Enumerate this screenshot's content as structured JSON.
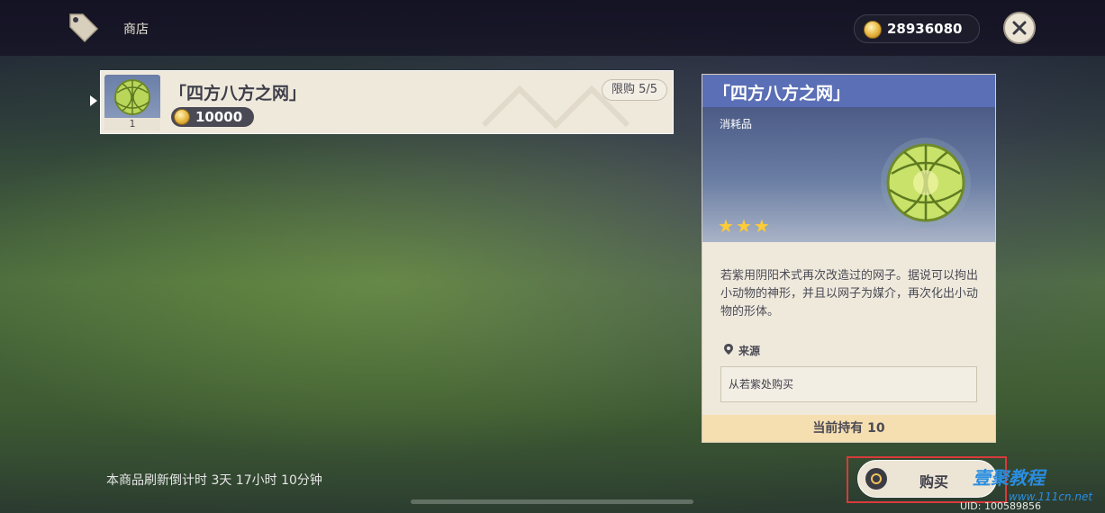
{
  "header": {
    "shop_title": "商店",
    "currency_amount": "28936080"
  },
  "shop_item": {
    "name": "「四方八方之网」",
    "price": "10000",
    "limit": "限购 5/5",
    "stack_count": "1"
  },
  "detail": {
    "title": "「四方八方之网」",
    "type": "消耗品",
    "rarity_stars": 3,
    "description": "若紫用阴阳术式再次改造过的网子。据说可以拘出小动物的神形，并且以网子为媒介，再次化出小动物的形体。",
    "source_label": "来源",
    "source_value": "从若紫处购买",
    "owned": "当前持有 10"
  },
  "footer": {
    "refresh_text": "本商品刷新倒计时 3天 17小时 10分钟",
    "buy_label": "购买",
    "uid": "UID: 100589856"
  },
  "watermark": {
    "brand": "壹聚教程",
    "url": "www.111cn.net"
  },
  "colors": {
    "header_blue": "#5a6fb5",
    "card_bg": "#efe9dc",
    "owned_bar": "#f5deb0",
    "highlight_red": "#d83a3a",
    "star": "#ffcc33"
  },
  "icons": [
    "shop-tag-icon",
    "coin-icon",
    "close-icon",
    "location-pin-icon",
    "star-icon",
    "buy-ring-icon"
  ]
}
